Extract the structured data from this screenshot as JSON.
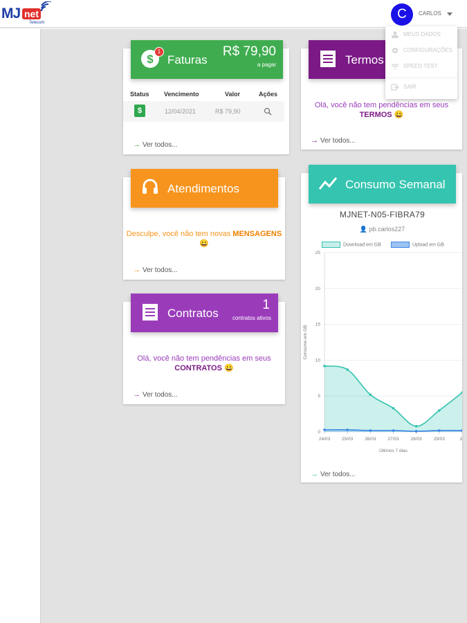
{
  "brand": {
    "logo_main": "MJ",
    "logo_badge": "net",
    "logo_sub": "Telecom"
  },
  "user": {
    "initial": "C",
    "name": "CARLOS"
  },
  "dropdown": {
    "items": [
      {
        "label": "MEUS DADOS",
        "icon": "user-icon"
      },
      {
        "label": "CONFIGURAÇÕES",
        "icon": "gear-icon"
      },
      {
        "label": "SPEED TEST",
        "icon": "wifi-icon"
      },
      {
        "label": "SAIR",
        "icon": "logout-icon"
      }
    ]
  },
  "faturas": {
    "title": "Faturas",
    "badge": "1",
    "amount": "R$ 79,90",
    "amount_sub": "a pagar",
    "columns": [
      "Status",
      "Vencimento",
      "Valor",
      "Ações"
    ],
    "rows": [
      {
        "status": "$",
        "vencimento": "12/04/2021",
        "valor": "R$ 79,90"
      }
    ],
    "footer": "Ver todos..."
  },
  "termos": {
    "title": "Termos",
    "msg_line1": "Olá, você não tem pendências em seus",
    "msg_strong": "TERMOS",
    "emoji": "😀",
    "footer": "Ver todos..."
  },
  "atendimentos": {
    "title": "Atendimentos",
    "msg_line1": "Desculpe, você não tem novas",
    "msg_strong": "MENSAGENS",
    "emoji": "😀",
    "footer": "Ver todos..."
  },
  "contratos": {
    "title": "Contratos",
    "count": "1",
    "count_sub": "contratos ativos",
    "msg_line1": "Olá, você não tem pendências em seus",
    "msg_strong": "CONTRATOS",
    "emoji": "😀",
    "footer": "Ver todos..."
  },
  "consumo": {
    "title": "Consumo Semanal",
    "device": "MJNET-N05-FIBRA79",
    "user_login": "pb.carlos227",
    "footer": "Ver todos..."
  },
  "colors": {
    "faturas": "#3fad4f",
    "termos": "#7b1a86",
    "atendimentos": "#f7941d",
    "contratos": "#9a3cba",
    "consumo": "#35c4b0",
    "download": "#34c3b0",
    "upload": "#3d86e6"
  },
  "chart_data": {
    "type": "area",
    "ylabel": "Consumo em GB",
    "xlabel": "Últimos 7 dias",
    "ylim": [
      0,
      25
    ],
    "yticks": [
      0,
      5,
      10,
      15,
      20,
      25
    ],
    "categories": [
      "24/03",
      "25/03",
      "26/03",
      "27/03",
      "28/03",
      "29/03",
      "30"
    ],
    "series": [
      {
        "name": "Download em GB",
        "values": [
          9.2,
          8.7,
          5.2,
          3.3,
          0.8,
          3.0,
          5.5
        ]
      },
      {
        "name": "Upload em GB",
        "values": [
          0.3,
          0.3,
          0.2,
          0.2,
          0.1,
          0.2,
          0.2
        ]
      }
    ],
    "grid": true,
    "legend": "top"
  }
}
